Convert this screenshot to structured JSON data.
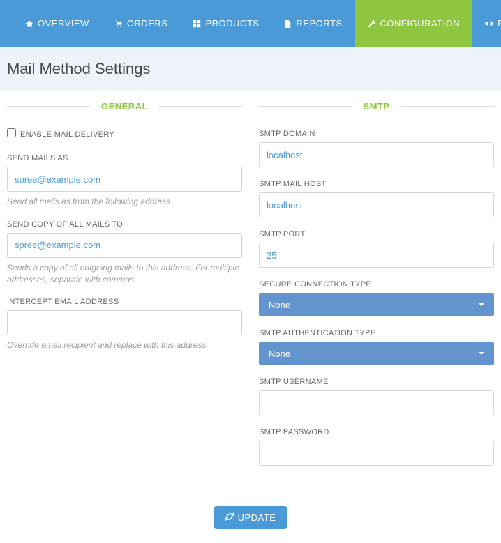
{
  "nav": {
    "overview": "Overview",
    "orders": "Orders",
    "products": "Products",
    "reports": "Reports",
    "configuration": "Configuration",
    "promotions_initial": "P"
  },
  "page": {
    "title": "Mail Method Settings"
  },
  "general": {
    "legend": "General",
    "enable_label": "Enable Mail Delivery",
    "enable_checked": false,
    "send_as_label": "Send Mails As",
    "send_as_value": "spree@example.com",
    "send_as_hint": "Send all mails as from the following address.",
    "copy_to_label": "Send Copy of All Mails To",
    "copy_to_value": "spree@example.com",
    "copy_to_hint": "Sends a copy of all outgoing mails to this address. For multiple addresses, separate with commas.",
    "intercept_label": "Intercept Email Address",
    "intercept_value": "",
    "intercept_hint": "Override email recipient and replace with this address."
  },
  "smtp": {
    "legend": "SMTP",
    "domain_label": "SMTP Domain",
    "domain_value": "localhost",
    "host_label": "SMTP Mail Host",
    "host_value": "localhost",
    "port_label": "SMTP Port",
    "port_value": "25",
    "secure_label": "Secure Connection Type",
    "secure_value": "None",
    "auth_label": "SMTP Authentication Type",
    "auth_value": "None",
    "username_label": "SMTP Username",
    "username_value": "",
    "password_label": "SMTP Password",
    "password_value": ""
  },
  "actions": {
    "update": "Update"
  }
}
